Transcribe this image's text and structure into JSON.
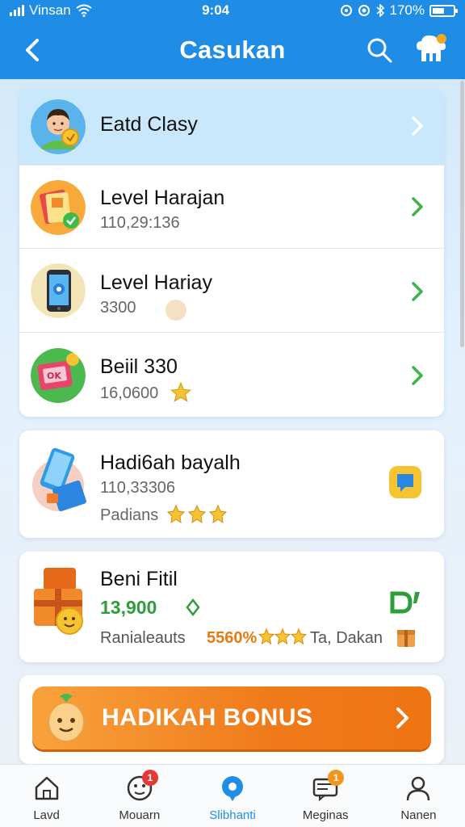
{
  "status_bar": {
    "carrier": "Vinsan",
    "time": "9:04",
    "battery": "170%"
  },
  "app_bar": {
    "title": "Casukan"
  },
  "list": [
    {
      "title": "Eatd Clasy",
      "subtitle": ""
    },
    {
      "title": "Level Harajan",
      "subtitle": "110,29:136"
    },
    {
      "title": "Level Hariay",
      "subtitle": "3300"
    },
    {
      "title": "Beiil 330",
      "subtitle": "16,0600"
    }
  ],
  "gift_1": {
    "title": "Hadi6ah bayalh",
    "value": "110,33306",
    "note": "Padians"
  },
  "gift_2": {
    "title": "Beni Fitil",
    "amount": "13,900",
    "note_prefix": "Ranialeauts",
    "percent": "5560%",
    "note_suffix": "Ta, Dakan"
  },
  "bonus_button": {
    "label": "HADIKAH BONUS"
  },
  "tabs": [
    {
      "label": "Lavd",
      "icon": "home-icon",
      "active": false
    },
    {
      "label": "Mouarn",
      "icon": "emoji-icon",
      "active": false,
      "badge": "1"
    },
    {
      "label": "Slibhanti",
      "icon": "chat-bubble-icon",
      "active": true
    },
    {
      "label": "Meginas",
      "icon": "inbox-icon",
      "active": false,
      "badge": "1"
    },
    {
      "label": "Nanen",
      "icon": "person-icon",
      "active": false
    }
  ],
  "colors": {
    "primary": "#1f8de6",
    "accent_orange": "#f07a1a",
    "chevron_green": "#3bb54a",
    "amount_green": "#2e9e3a",
    "percent_orange": "#e87a10"
  }
}
